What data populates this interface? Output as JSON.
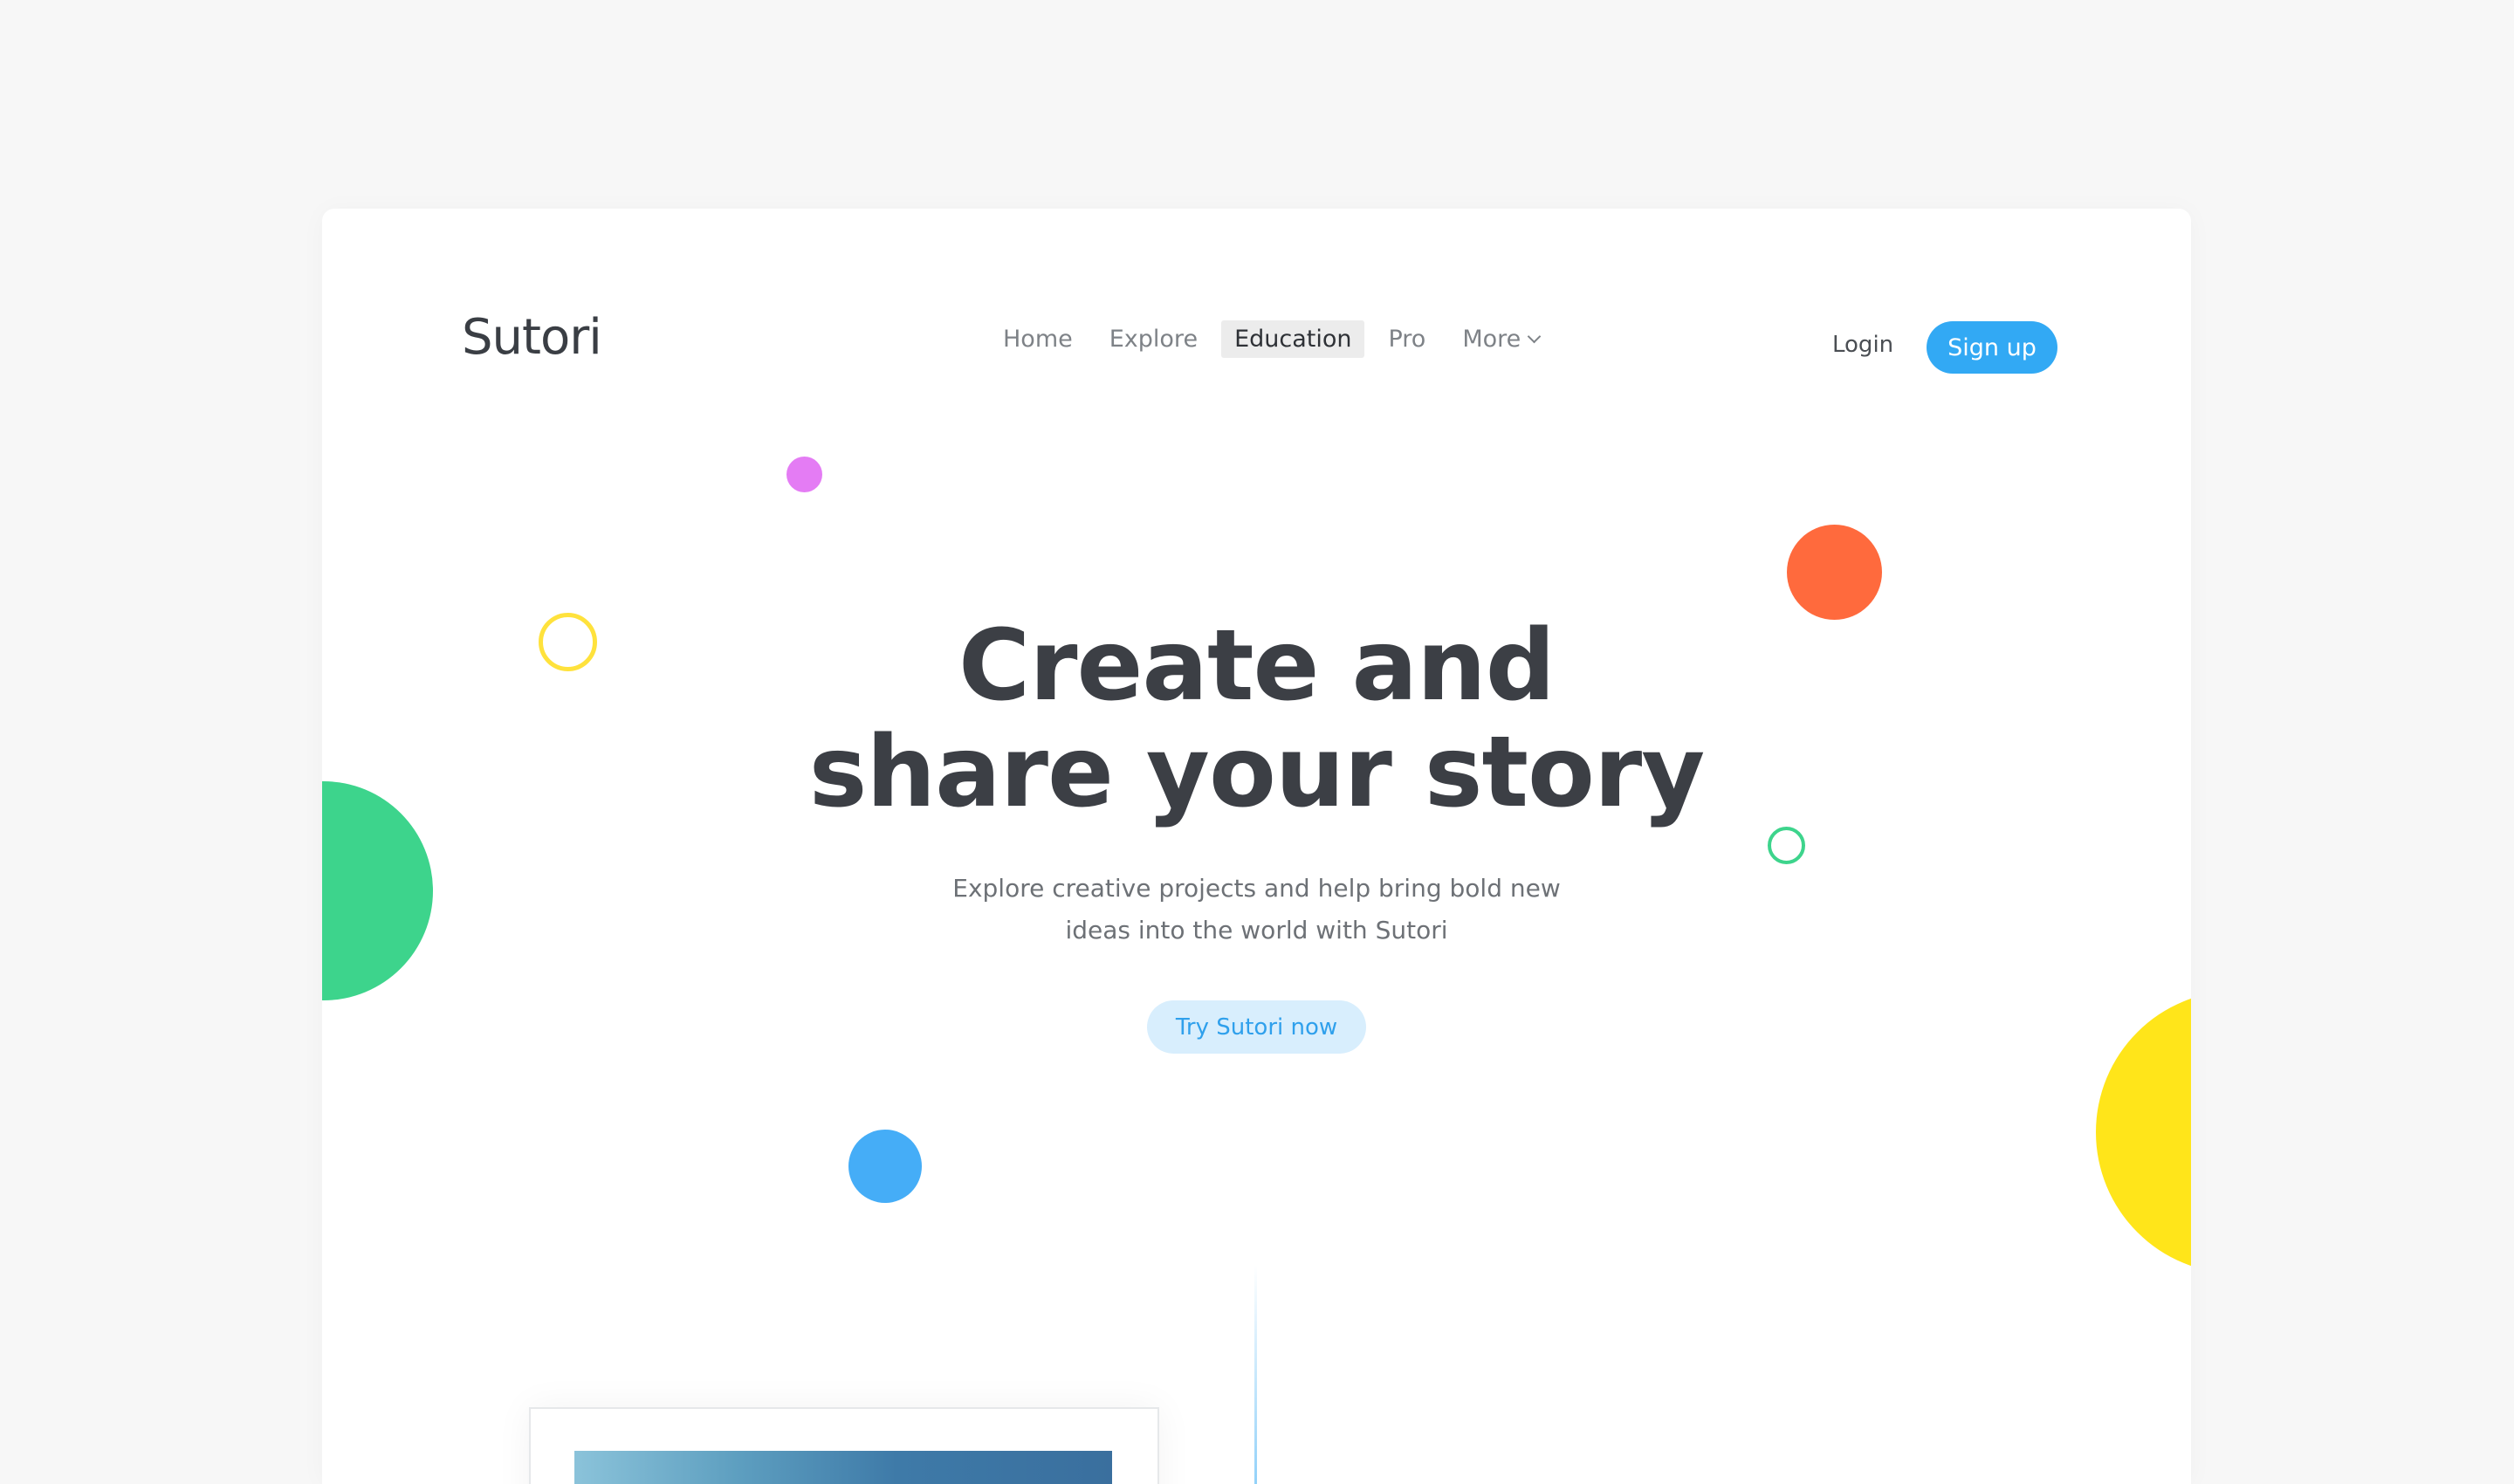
{
  "brand": {
    "logo_text": "Sutori"
  },
  "nav": {
    "items": [
      {
        "label": "Home",
        "active": false
      },
      {
        "label": "Explore",
        "active": false
      },
      {
        "label": "Education",
        "active": true
      },
      {
        "label": "Pro",
        "active": false
      },
      {
        "label": "More",
        "active": false,
        "has_dropdown": true
      }
    ]
  },
  "auth": {
    "login_label": "Login",
    "signup_label": "Sign up"
  },
  "hero": {
    "headline_line1": "Create and",
    "headline_line2": "share your story",
    "subtext_line1": "Explore creative projects and help bring bold new",
    "subtext_line2": "ideas into the world with Sutori",
    "cta_label": "Try Sutori now"
  },
  "colors": {
    "accent_blue": "#32a9f4",
    "cta_bg": "#d8eefd",
    "headline": "#3c3f45",
    "deco_pink": "#e47cf4",
    "deco_yellow": "#ffe51a",
    "deco_orange": "#ff6a3d",
    "deco_green": "#3dd48c",
    "deco_blue": "#45adf7"
  }
}
